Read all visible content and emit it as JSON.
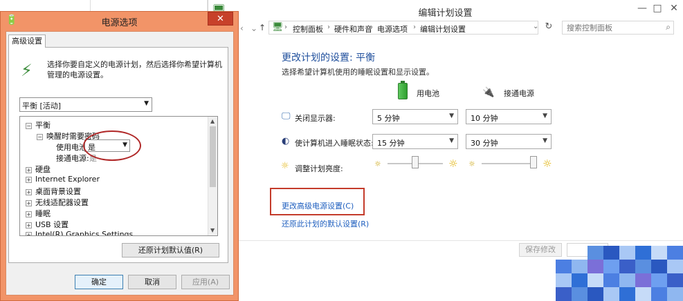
{
  "main_window": {
    "title": "编辑计划设置",
    "breadcrumbs": [
      "控制面板",
      "硬件和声音",
      "电源选项",
      "编辑计划设置"
    ],
    "search_placeholder": "搜索控制面板",
    "heading": "更改计划的设置: 平衡",
    "subheading": "选择希望计算机使用的睡眠设置和显示设置。",
    "col_battery": "用电池",
    "col_plugged": "接通电源",
    "rows": [
      {
        "label": "关闭显示器:",
        "battery": "5 分钟",
        "plugged": "10 分钟",
        "icon": "monitor-icon"
      },
      {
        "label": "使计算机进入睡眠状态:",
        "battery": "15 分钟",
        "plugged": "30 分钟",
        "icon": "moon-icon"
      }
    ],
    "brightness_label": "调整计划亮度:",
    "brightness_battery": 0.5,
    "brightness_plugged": 1.0,
    "advanced_link": "更改高级电源设置(C)",
    "restore_link": "还原此计划的默认设置(R)",
    "save_button": "保存修改"
  },
  "dialog": {
    "title": "电源选项",
    "close": "✕",
    "tab": "高级设置",
    "description": "选择你要自定义的电源计划，然后选择你希望计算机管理的电源设置。",
    "plan_select": "平衡 [活动]",
    "tree": {
      "root": "平衡",
      "child": "唤醒时需要密码",
      "battery_label": "使用电池:",
      "battery_value": "是",
      "plugged_label": "接通电源:",
      "plugged_value": "是",
      "items": [
        "硬盘",
        "Internet Explorer",
        "桌面背景设置",
        "无线适配器设置",
        "睡眠",
        "USB 设置",
        "Intel(R) Graphics Settings"
      ]
    },
    "restore_button": "还原计划默认值(R)",
    "ok_button": "确定",
    "cancel_button": "取消",
    "apply_button": "应用(A)"
  },
  "window_controls": {
    "minimize": "—",
    "maximize": "□",
    "close": "✕"
  },
  "colors": {
    "dialog_frame": "#f29468",
    "close_red": "#c7412a",
    "link_blue": "#1f5fbf",
    "highlight_red": "#c43b2b"
  }
}
